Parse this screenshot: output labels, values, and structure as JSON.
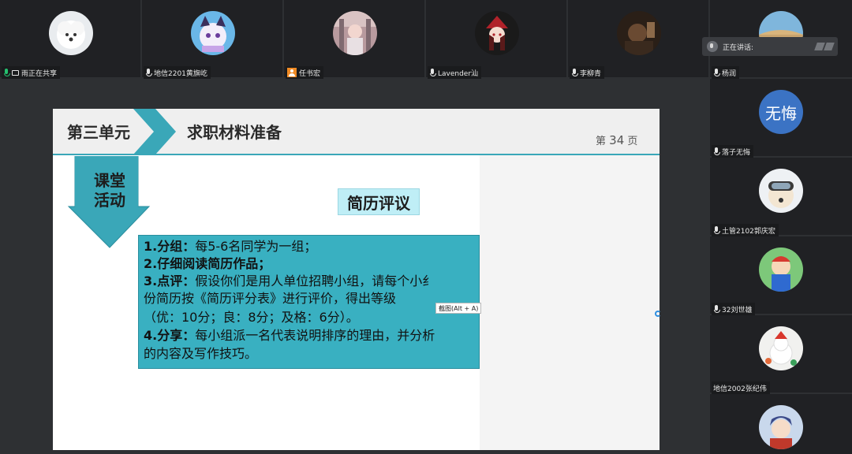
{
  "top_participants": [
    {
      "name": "雨正在共享",
      "mic": "green",
      "share": true
    },
    {
      "name": "地信2201黄旗屹",
      "mic": "white"
    },
    {
      "name": "任书宏",
      "user_icon": true
    },
    {
      "name": "Lavender汕",
      "mic": "white"
    },
    {
      "name": "李柳青",
      "mic": "white"
    }
  ],
  "right_participants": [
    {
      "name": "杨润",
      "mic": "white"
    },
    {
      "name": "落子无悔",
      "mic": "white",
      "avatar_text": "无悔"
    },
    {
      "name": "土管2102郭庆宏",
      "mic": "white"
    },
    {
      "name": "32刘世雄",
      "mic": "white"
    },
    {
      "name": "地信2002张纪伟",
      "mic": "none"
    }
  ],
  "speaking": {
    "label": "正在讲话:"
  },
  "slide": {
    "unit_title": "第三单元",
    "unit_subtitle": "求职材料准备",
    "page_prefix": "第",
    "page_number": "34",
    "page_suffix": "页",
    "activity_label_1": "课堂",
    "activity_label_2": "活动",
    "review_title": "简历评议",
    "lines": [
      {
        "bold": "1.分组：",
        "text": "每5-6名同学为一组；"
      },
      {
        "bold": "2.仔细阅读简历作品；",
        "text": ""
      },
      {
        "bold": "3.点评：",
        "text": "假设你们是用人单位招聘小组，请每个小纟"
      },
      {
        "bold": "",
        "text": "份简历按《简历评分表》进行评价，得出等级"
      },
      {
        "bold": "",
        "text": "（优：10分；良：8分；及格：6分）。"
      },
      {
        "bold": "4.分享：",
        "text": "每小组派一名代表说明排序的理由，并分析"
      },
      {
        "bold": "",
        "text": "的内容及写作技巧。"
      }
    ],
    "tooltip": "截图(Alt + A)"
  },
  "colors": {
    "accent": "#3aa7b8",
    "content_box": "#39b0c1",
    "review_bg": "#bfeef6",
    "text_avatar": "#3b73c4"
  }
}
